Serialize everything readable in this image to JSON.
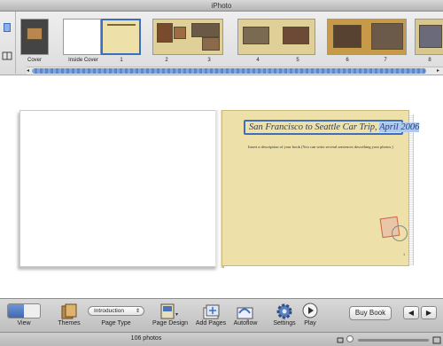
{
  "window": {
    "title": "iPhoto"
  },
  "thumbnails": [
    {
      "label": "Cover"
    },
    {
      "label": "Inside Cover"
    },
    {
      "label": "1"
    },
    {
      "label": "2"
    },
    {
      "label": "3"
    },
    {
      "label": "4"
    },
    {
      "label": "5"
    },
    {
      "label": "6"
    },
    {
      "label": "7"
    },
    {
      "label": "8"
    }
  ],
  "book": {
    "title_main": "San Francisco to Seattle Car Trip, ",
    "title_selected": "April 2006",
    "description": "Insert a description of your book (You can write several sentences describing your photos.)",
    "page_number": "1"
  },
  "toolbar": {
    "view": "View",
    "themes": "Themes",
    "page_type_value": "Introduction",
    "page_type": "Page Type",
    "page_design": "Page Design",
    "add_pages": "Add Pages",
    "autoflow": "Autoflow",
    "settings": "Settings",
    "play": "Play",
    "buy_book": "Buy Book"
  },
  "status": {
    "photo_count": "106 photos"
  },
  "icons": {
    "prev": "arrow-left-icon",
    "next": "arrow-right-icon"
  },
  "colors": {
    "selection": "#3d6fc1",
    "page": "#ede0a8"
  }
}
